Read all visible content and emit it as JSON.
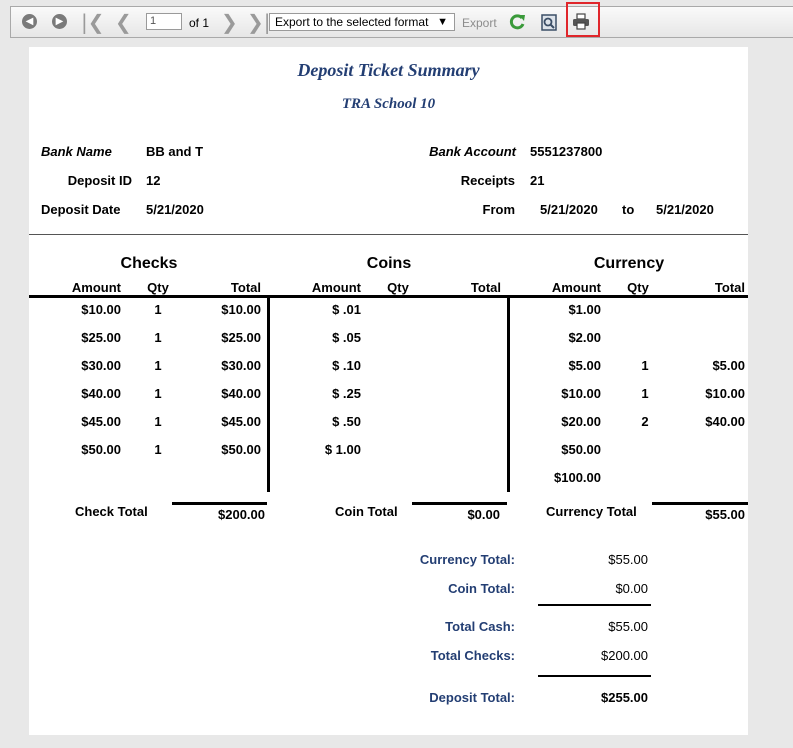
{
  "toolbar": {
    "page_current": "1",
    "page_of": "of 1",
    "export_format": "Export to the selected format",
    "export_label": "Export"
  },
  "report": {
    "title": "Deposit Ticket Summary",
    "school": "TRA School 10",
    "bank_name_label": "Bank Name",
    "bank_name": "BB and T",
    "deposit_id_label": "Deposit ID",
    "deposit_id": "12",
    "deposit_date_label": "Deposit Date",
    "deposit_date": "5/21/2020",
    "bank_account_label": "Bank Account",
    "bank_account": "5551237800",
    "receipts_label": "Receipts",
    "receipts": "21",
    "from_label": "From",
    "from_date": "5/21/2020",
    "to_label": "to",
    "to_date": "5/21/2020",
    "checks": {
      "heading": "Checks",
      "amount_header": "Amount",
      "qty_header": "Qty",
      "total_header": "Total",
      "rows": [
        {
          "amount": "$10.00",
          "qty": "1",
          "total": "$10.00"
        },
        {
          "amount": "$25.00",
          "qty": "1",
          "total": "$25.00"
        },
        {
          "amount": "$30.00",
          "qty": "1",
          "total": "$30.00"
        },
        {
          "amount": "$40.00",
          "qty": "1",
          "total": "$40.00"
        },
        {
          "amount": "$45.00",
          "qty": "1",
          "total": "$45.00"
        },
        {
          "amount": "$50.00",
          "qty": "1",
          "total": "$50.00"
        }
      ],
      "total_label": "Check Total",
      "total_value": "$200.00"
    },
    "coins": {
      "heading": "Coins",
      "amount_header": "Amount",
      "qty_header": "Qty",
      "total_header": "Total",
      "rows": [
        {
          "amount": "$ .01",
          "qty": "",
          "total": ""
        },
        {
          "amount": "$ .05",
          "qty": "",
          "total": ""
        },
        {
          "amount": "$ .10",
          "qty": "",
          "total": ""
        },
        {
          "amount": "$ .25",
          "qty": "",
          "total": ""
        },
        {
          "amount": "$ .50",
          "qty": "",
          "total": ""
        },
        {
          "amount": "$ 1.00",
          "qty": "",
          "total": ""
        }
      ],
      "total_label": "Coin Total",
      "total_value": "$0.00"
    },
    "currency": {
      "heading": "Currency",
      "amount_header": "Amount",
      "qty_header": "Qty",
      "total_header": "Total",
      "rows": [
        {
          "amount": "$1.00",
          "qty": "",
          "total": ""
        },
        {
          "amount": "$2.00",
          "qty": "",
          "total": ""
        },
        {
          "amount": "$5.00",
          "qty": "1",
          "total": "$5.00"
        },
        {
          "amount": "$10.00",
          "qty": "1",
          "total": "$10.00"
        },
        {
          "amount": "$20.00",
          "qty": "2",
          "total": "$40.00"
        },
        {
          "amount": "$50.00",
          "qty": "",
          "total": ""
        },
        {
          "amount": "$100.00",
          "qty": "",
          "total": ""
        }
      ],
      "total_label": "Currency Total",
      "total_value": "$55.00"
    },
    "summary": {
      "currency_total_label": "Currency Total:",
      "currency_total": "$55.00",
      "coin_total_label": "Coin Total:",
      "coin_total": "$0.00",
      "total_cash_label": "Total Cash:",
      "total_cash": "$55.00",
      "total_checks_label": "Total Checks:",
      "total_checks": "$200.00",
      "deposit_total_label": "Deposit Total:",
      "deposit_total": "$255.00"
    }
  },
  "colors": {
    "title_navy": "#233e73",
    "highlight_red": "#e0262b",
    "refresh_green": "#3a9a3a"
  },
  "icons": [
    "back-icon",
    "forward-icon",
    "first-page-icon",
    "prev-page-icon",
    "next-page-icon",
    "last-page-icon",
    "refresh-icon",
    "zoom-icon",
    "print-icon"
  ]
}
